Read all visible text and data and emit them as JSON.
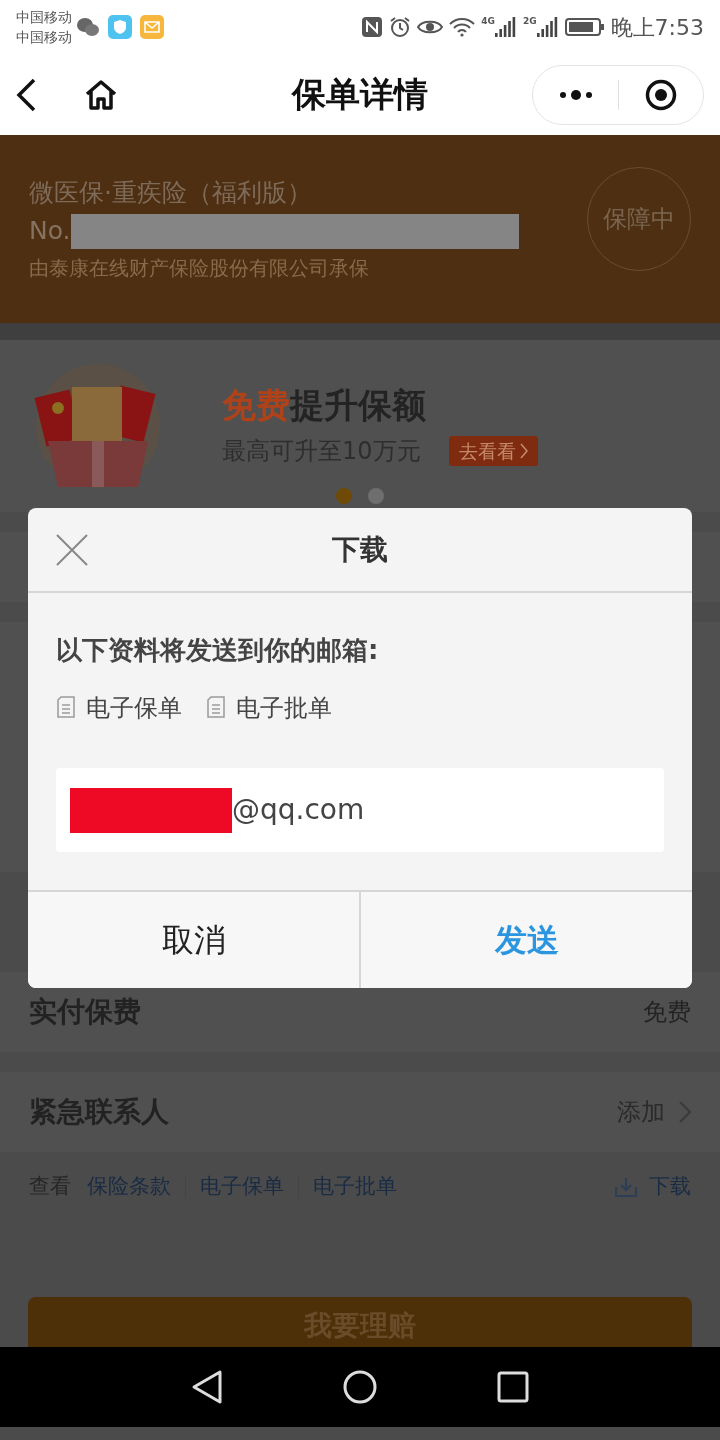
{
  "status_bar": {
    "carriers": [
      "中国移动",
      "中国移动"
    ],
    "network_labels": [
      "4G",
      "2G"
    ],
    "time": "晚上7:53"
  },
  "nav": {
    "title": "保单详情"
  },
  "policy": {
    "name": "微医保·重疾险（福利版）",
    "number_prefix": "No.",
    "insurer": "由泰康在线财产保险股份有限公司承保",
    "status": "保障中"
  },
  "promo": {
    "highlight": "免费",
    "title": "提升保额",
    "subtitle": "最高可升至10万元",
    "button": "去看看",
    "dots": [
      {
        "selected": true
      },
      {
        "selected": false
      }
    ]
  },
  "dialog": {
    "title": "下载",
    "message": "以下资料将发送到你的邮箱:",
    "documents": [
      "电子保单",
      "电子批单"
    ],
    "email": {
      "value": "@qq.com"
    },
    "buttons": [
      {
        "label": "取消",
        "kind": "cancel"
      },
      {
        "label": "发送",
        "kind": "primary"
      }
    ]
  },
  "rows": [
    {
      "label": "实付保费",
      "value": "免费",
      "chevron": false
    },
    {
      "label": "紧急联系人",
      "value": "添加",
      "chevron": true
    }
  ],
  "links": {
    "prefix": "查看",
    "items": [
      "保险条款",
      "电子保单",
      "电子批单"
    ],
    "download": "下载"
  },
  "claim_button": "我要理赔"
}
